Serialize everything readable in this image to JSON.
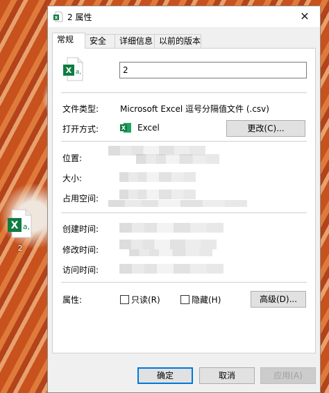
{
  "desktop": {
    "file_label": "2"
  },
  "window": {
    "title": "2 属性",
    "close_glyph": "✕"
  },
  "tabs": [
    {
      "label": "常规",
      "active": true
    },
    {
      "label": "安全",
      "active": false
    },
    {
      "label": "详细信息",
      "active": false
    },
    {
      "label": "以前的版本",
      "active": false
    }
  ],
  "general": {
    "file_name": "2",
    "file_type_label": "文件类型:",
    "file_type_value": "Microsoft Excel 逗号分隔值文件 (.csv)",
    "open_with_label": "打开方式:",
    "open_with_app": "Excel",
    "change_button": "更改(C)...",
    "location_label": "位置:",
    "size_label": "大小:",
    "size_on_disk_label": "占用空间:",
    "created_label": "创建时间:",
    "modified_label": "修改时间:",
    "accessed_label": "访问时间:",
    "attributes_label": "属性:",
    "readonly_label": "只读(R)",
    "hidden_label": "隐藏(H)",
    "advanced_button": "高级(D)..."
  },
  "footer": {
    "ok": "确定",
    "cancel": "取消",
    "apply": "应用(A)"
  },
  "colors": {
    "excel_green": "#107C41",
    "accent": "#0078d7"
  }
}
